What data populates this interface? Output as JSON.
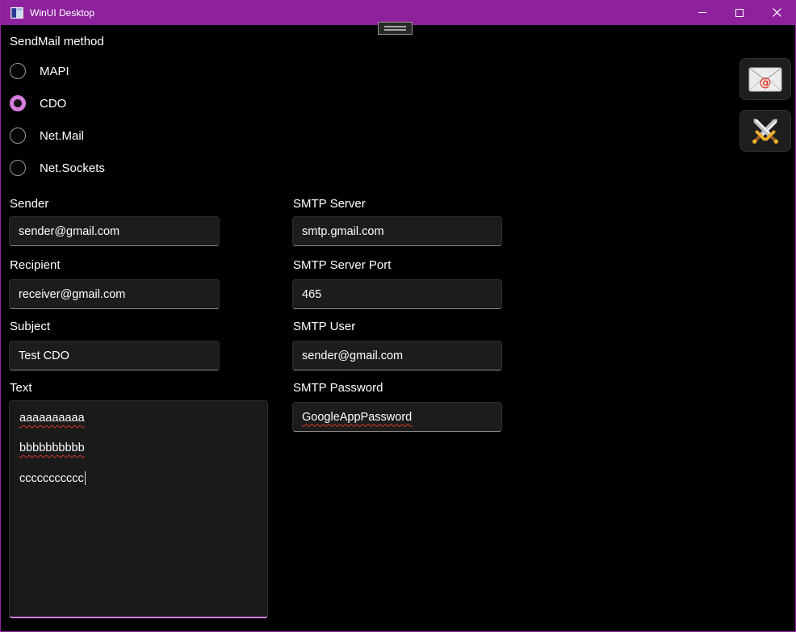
{
  "titlebar": {
    "title": "WinUI Desktop"
  },
  "radio_group": {
    "label": "SendMail method",
    "options": [
      {
        "label": "MAPI",
        "selected": false
      },
      {
        "label": "CDO",
        "selected": true
      },
      {
        "label": "Net.Mail",
        "selected": false
      },
      {
        "label": "Net.Sockets",
        "selected": false
      }
    ]
  },
  "action_buttons": [
    {
      "icon": "email-envelope-icon"
    },
    {
      "icon": "crossed-swords-icon"
    }
  ],
  "form": {
    "sender": {
      "label": "Sender",
      "value": "sender@gmail.com"
    },
    "recipient": {
      "label": "Recipient",
      "value": "receiver@gmail.com"
    },
    "subject": {
      "label": "Subject",
      "value": "Test CDO"
    },
    "text": {
      "label": "Text",
      "lines": [
        "aaaaaaaaaa",
        "bbbbbbbbbb",
        "ccccccccccc"
      ]
    },
    "smtp_server": {
      "label": "SMTP Server",
      "value": "smtp.gmail.com"
    },
    "smtp_port": {
      "label": "SMTP Server Port",
      "value": "465"
    },
    "smtp_user": {
      "label": "SMTP User",
      "value": "sender@gmail.com"
    },
    "smtp_password": {
      "label": "SMTP Password",
      "value": "GoogleAppPassword"
    }
  },
  "colors": {
    "titlebar": "#8E219C",
    "accent": "#D57DDB",
    "focus_underline": "#C97FD4",
    "spellcheck_underline": "#D6392C"
  }
}
